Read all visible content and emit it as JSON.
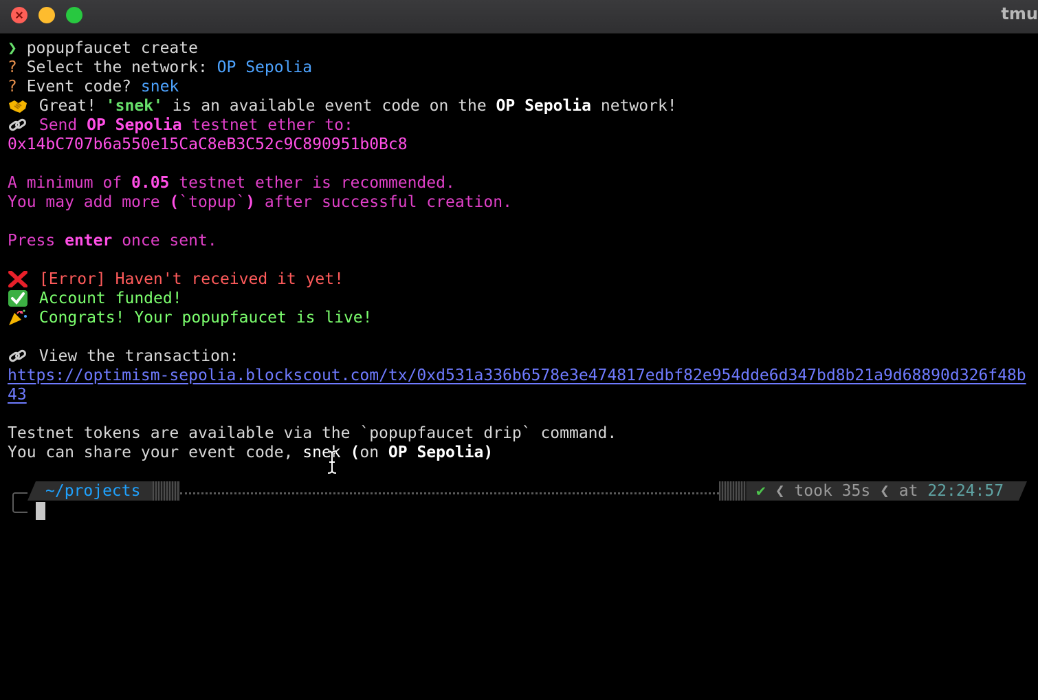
{
  "window": {
    "title": "tmu"
  },
  "lines": {
    "l1": {
      "glyph": "❯",
      "text": " popupfaucet create"
    },
    "l2": {
      "q": "?",
      "text": " Select the network: ",
      "value": "OP Sepolia"
    },
    "l3": {
      "q": "?",
      "text": " Event code? ",
      "value": "snek"
    },
    "l4": {
      "a": " Great! ",
      "code": "'snek'",
      "b": " is an available event code on the ",
      "net": "OP Sepolia",
      "c": " network!"
    },
    "l5": {
      "a": " Send ",
      "net": "OP Sepolia",
      "b": " testnet ether to:"
    },
    "l6": {
      "address": "0x14bC707b6a550e15CaC8eB3C52c9C890951b0Bc8"
    },
    "l8": {
      "a": "A minimum of ",
      "amount": "0.05",
      "b": " testnet ether is recommended."
    },
    "l9": {
      "a": "You may add more ",
      "b": "(",
      "c": "`topup`",
      "d": ")",
      "e": " after successful creation."
    },
    "l11": {
      "a": "Press ",
      "key": "enter",
      "b": " once sent."
    },
    "l13": {
      "text": " [Error] Haven't received it yet!"
    },
    "l14": {
      "text": " Account funded!"
    },
    "l15": {
      "text": " Congrats! Your popupfaucet is live!"
    },
    "l17": {
      "text": " View the transaction:"
    },
    "l18": {
      "url": "https://optimism-sepolia.blockscout.com/tx/0xd531a336b6578e3e474817edbf82e954dde6d347bd8b21a9d68890d326f48b"
    },
    "l19": {
      "url_end": "43"
    },
    "l21": {
      "text": "Testnet tokens are available via the `popupfaucet drip` command."
    },
    "l22": {
      "a": "You can share your event code, ",
      "code": "snek",
      "b": " (",
      "c": "on ",
      "net": "OP Sepolia",
      "d": ")"
    }
  },
  "prompt": {
    "path": "~/projects",
    "status_check": "✔",
    "took_label": "took ",
    "duration": "35s",
    "at_label": "at ",
    "time": "22:24:57"
  },
  "icons": [
    "handshake-icon",
    "link-icon",
    "cross-mark-icon",
    "check-mark-icon",
    "party-popper-icon",
    "link-icon"
  ]
}
